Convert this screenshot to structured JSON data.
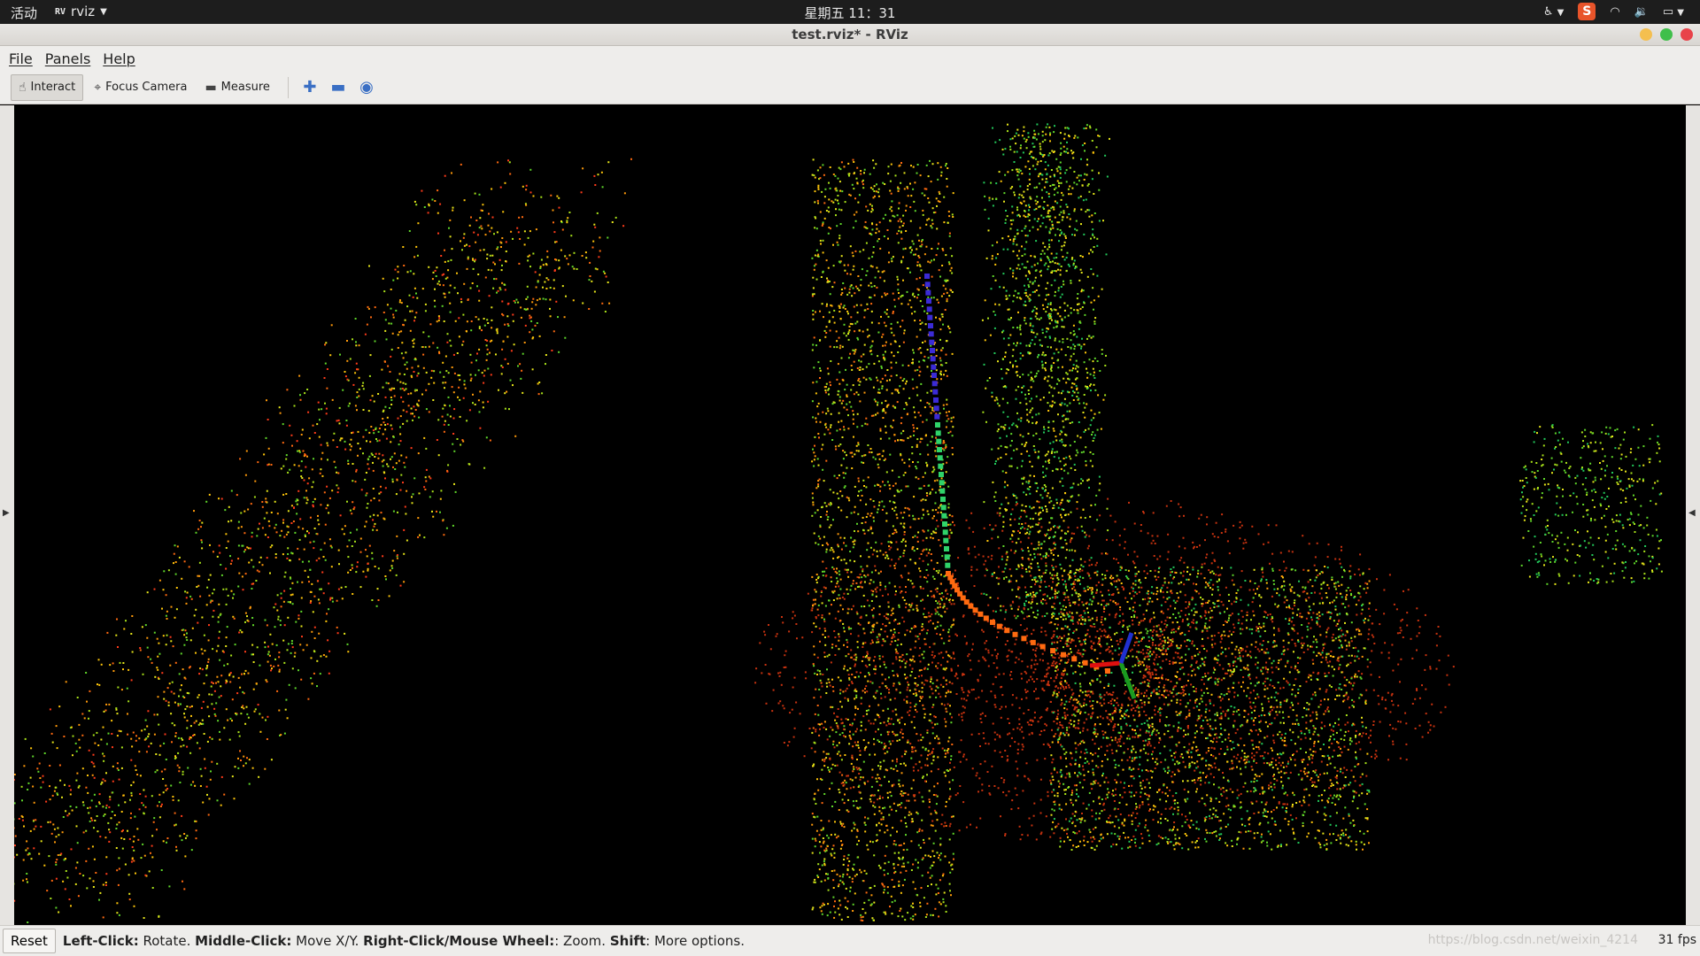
{
  "system_bar": {
    "activities": "活动",
    "app_icon": "RV",
    "app_name": "rviz",
    "clock": "星期五 11：31",
    "tray_icons": [
      "accessibility-icon",
      "sogou-input-icon",
      "wifi-icon",
      "volume-icon",
      "battery-icon"
    ],
    "sogou_letter": "S"
  },
  "window": {
    "title": "test.rviz* - RViz",
    "buttons": {
      "minimize_color": "#f4bf4f",
      "maximize_color": "#3fbf4a",
      "close_color": "#e8434a"
    }
  },
  "menu": [
    "File",
    "Panels",
    "Help"
  ],
  "toolbar": {
    "interact": "Interact",
    "focus_camera": "Focus Camera",
    "measure": "Measure",
    "icons": [
      "move-camera-plus-icon",
      "select-minus-icon",
      "publish-point-icon"
    ]
  },
  "status": {
    "reset": "Reset",
    "hint_left_label": "Left-Click:",
    "hint_left": " Rotate. ",
    "hint_mid_label": "Middle-Click:",
    "hint_mid": " Move X/Y. ",
    "hint_right_label": "Right-Click/Mouse Wheel:",
    "hint_right": ": Zoom. ",
    "hint_shift_label": "Shift",
    "hint_shift": ": More options.",
    "fps": "31 fps",
    "watermark": "https://blog.csdn.net/weixin_4214"
  },
  "colors": {
    "background": "#000000",
    "path_start": "#3b2bd6",
    "path_mid": "#2fd36a",
    "path_end": "#ff6a10"
  }
}
